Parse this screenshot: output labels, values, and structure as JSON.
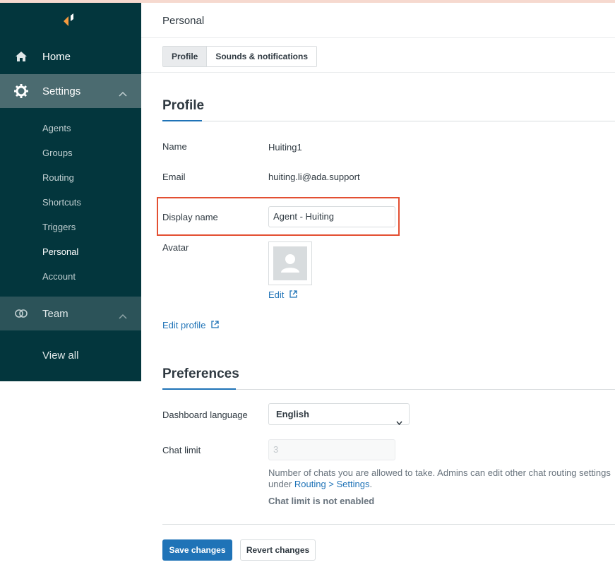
{
  "sidebar": {
    "home_label": "Home",
    "settings_label": "Settings",
    "settings_items": [
      "Agents",
      "Groups",
      "Routing",
      "Shortcuts",
      "Triggers",
      "Personal",
      "Account"
    ],
    "active_item": "Personal",
    "team_label": "Team",
    "view_all_label": "View all"
  },
  "header": {
    "title": "Personal"
  },
  "tabs": [
    {
      "label": "Profile",
      "active": true
    },
    {
      "label": "Sounds & notifications",
      "active": false
    }
  ],
  "profile": {
    "section_title": "Profile",
    "name_label": "Name",
    "name_value": "Huiting1",
    "email_label": "Email",
    "email_value": "huiting.li@ada.support",
    "display_name_label": "Display name",
    "display_name_value": "Agent - Huiting",
    "avatar_label": "Avatar",
    "avatar_edit_link": "Edit",
    "edit_profile_link": "Edit profile"
  },
  "preferences": {
    "section_title": "Preferences",
    "language_label": "Dashboard language",
    "language_value": "English",
    "chat_limit_label": "Chat limit",
    "chat_limit_value": "3",
    "hint_text": "Number of chats you are allowed to take. Admins can edit other chat routing settings under",
    "hint_link": "Routing > Settings",
    "hint_period": ".",
    "chat_limit_status": "Chat limit is not enabled"
  },
  "actions": {
    "save_label": "Save changes",
    "revert_label": "Revert changes"
  },
  "colors": {
    "sidebar_bg": "#03363d",
    "accent": "#1f73b7",
    "highlight": "#e34f32"
  }
}
